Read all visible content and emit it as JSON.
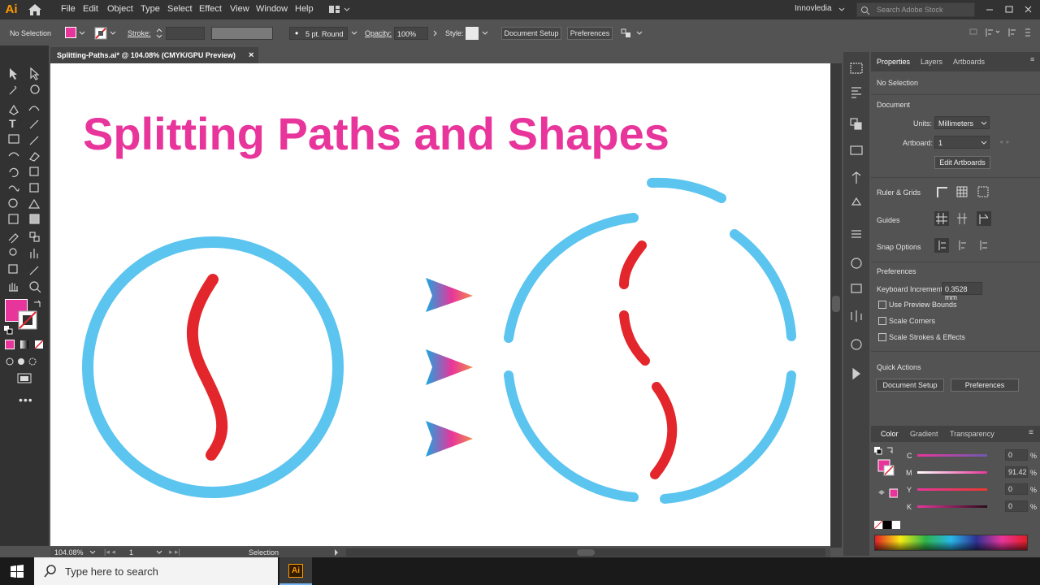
{
  "menubar": {
    "app_logo": "Ai",
    "items": [
      "File",
      "Edit",
      "Object",
      "Type",
      "Select",
      "Effect",
      "View",
      "Window",
      "Help"
    ],
    "workspace": "Innovledia",
    "search_placeholder": "Search Adobe Stock"
  },
  "controlbar": {
    "selection_label": "No Selection",
    "stroke_label": "Stroke:",
    "brush_label": "5 pt. Round",
    "opacity_label": "Opacity:",
    "opacity_value": "100%",
    "style_label": "Style:",
    "document_setup": "Document Setup",
    "preferences": "Preferences",
    "fill_color": "#e8359b"
  },
  "document": {
    "tab_title": "Splitting-Paths.ai* @ 104.08% (CMYK/GPU Preview)",
    "close_icon": "×"
  },
  "artwork": {
    "title": "Splitting Paths and Shapes",
    "title_color": "#e8359b",
    "circle_color": "#5bc4ef",
    "curve_color": "#e3262b"
  },
  "statusbar": {
    "zoom": "104.08%",
    "artboard_number": "1",
    "tool": "Selection"
  },
  "properties": {
    "tabs": [
      "Properties",
      "Layers",
      "Artboards"
    ],
    "selection_state": "No Selection",
    "document_heading": "Document",
    "units_label": "Units:",
    "units_value": "Millimeters",
    "artboard_label": "Artboard:",
    "artboard_value": "1",
    "edit_artboards": "Edit Artboards",
    "ruler_grids": "Ruler & Grids",
    "guides": "Guides",
    "snap_options": "Snap Options",
    "preferences_heading": "Preferences",
    "keyboard_increment_label": "Keyboard Increment:",
    "keyboard_increment_value": "0.3528 mm",
    "use_preview_bounds": "Use Preview Bounds",
    "scale_corners": "Scale Corners",
    "scale_strokes": "Scale Strokes & Effects",
    "quick_actions": "Quick Actions",
    "qa_document_setup": "Document Setup",
    "qa_preferences": "Preferences"
  },
  "color_panel": {
    "tabs": [
      "Color",
      "Gradient",
      "Transparency"
    ],
    "channels": [
      {
        "label": "C",
        "value": "0"
      },
      {
        "label": "M",
        "value": "91.42"
      },
      {
        "label": "Y",
        "value": "0"
      },
      {
        "label": "K",
        "value": "0"
      }
    ],
    "percent": "%"
  },
  "taskbar": {
    "search_text": "Type here to search",
    "app_badge": "Ai"
  }
}
